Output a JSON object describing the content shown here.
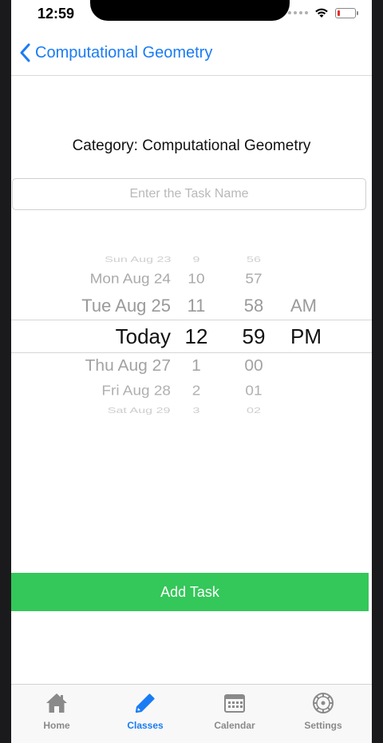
{
  "status": {
    "time": "12:59",
    "battery_level": 0.15
  },
  "nav": {
    "back_label": "Computational Geometry"
  },
  "category": {
    "text": "Category: Computational Geometry"
  },
  "task_input": {
    "placeholder": "Enter the Task Name",
    "value": ""
  },
  "picker": {
    "rows": [
      {
        "date": "Sun Aug 23",
        "hour": "9",
        "minute": "56",
        "ampm": ""
      },
      {
        "date": "Mon Aug 24",
        "hour": "10",
        "minute": "57",
        "ampm": ""
      },
      {
        "date": "Tue Aug 25",
        "hour": "11",
        "minute": "58",
        "ampm": "AM"
      },
      {
        "date": "Today",
        "hour": "12",
        "minute": "59",
        "ampm": "PM"
      },
      {
        "date": "Thu Aug 27",
        "hour": "1",
        "minute": "00",
        "ampm": ""
      },
      {
        "date": "Fri Aug 28",
        "hour": "2",
        "minute": "01",
        "ampm": ""
      },
      {
        "date": "Sat Aug 29",
        "hour": "3",
        "minute": "02",
        "ampm": ""
      }
    ]
  },
  "add_button": {
    "label": "Add Task",
    "color": "#34c759"
  },
  "tabbar": {
    "tabs": [
      {
        "label": "Home",
        "icon": "home-icon"
      },
      {
        "label": "Classes",
        "icon": "pencil-icon",
        "active": true
      },
      {
        "label": "Calendar",
        "icon": "calendar-icon"
      },
      {
        "label": "Settings",
        "icon": "settings-icon"
      }
    ]
  },
  "colors": {
    "accent": "#1a7cf4",
    "tab_inactive": "#8a8a8a",
    "battery_low": "#e0302a"
  }
}
